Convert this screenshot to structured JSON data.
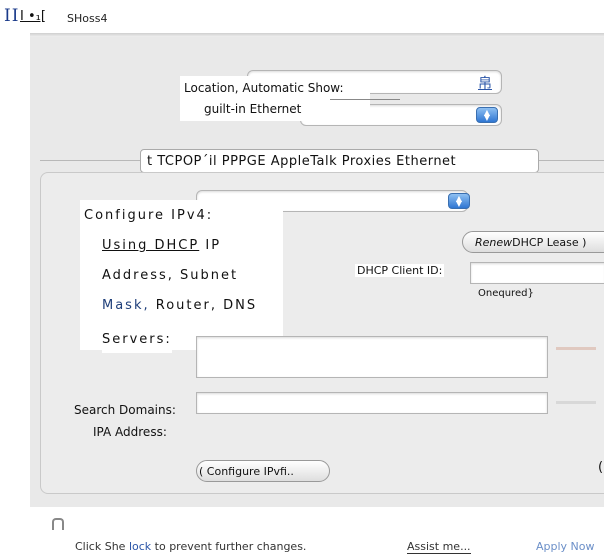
{
  "title": {
    "glyph_fragment": "II",
    "mark": "I •₁[",
    "name": "SHoss4"
  },
  "location": {
    "label": "Location, Automatic Show:",
    "show_value": "guilt-in Ethernet",
    "extra_glyph": "帛"
  },
  "tabs_text": "t TCPOP´il PPPGE AppleTalk Proxies Ethernet",
  "configure": {
    "label": "Configure IPv4:",
    "value_link": "Using DHCP",
    "value_rest": " IP",
    "line2": "Address, Subnet",
    "line3_link": "Mask,",
    "line3_rest": " Router, DNS",
    "line4": "Servers:"
  },
  "renew_button": {
    "italic": "Renew",
    "rest": " DHCP Lease )"
  },
  "client_id": {
    "label": "DHCP Client ID:",
    "hint": "Onequred}"
  },
  "search_domains_label": "Search Domains:",
  "ipa_address_label": "IPA Address:",
  "configure_ipv6_button": "( Configure IPvfi..",
  "bottom": {
    "lock_prefix": "Click She ",
    "lock_word": "lock",
    "lock_suffix": " to prevent further changes.",
    "assist": "Assist me...",
    "apply": "Apply Now"
  },
  "colors": {
    "accent": "#2f76d2",
    "link": "#2a55a8"
  }
}
